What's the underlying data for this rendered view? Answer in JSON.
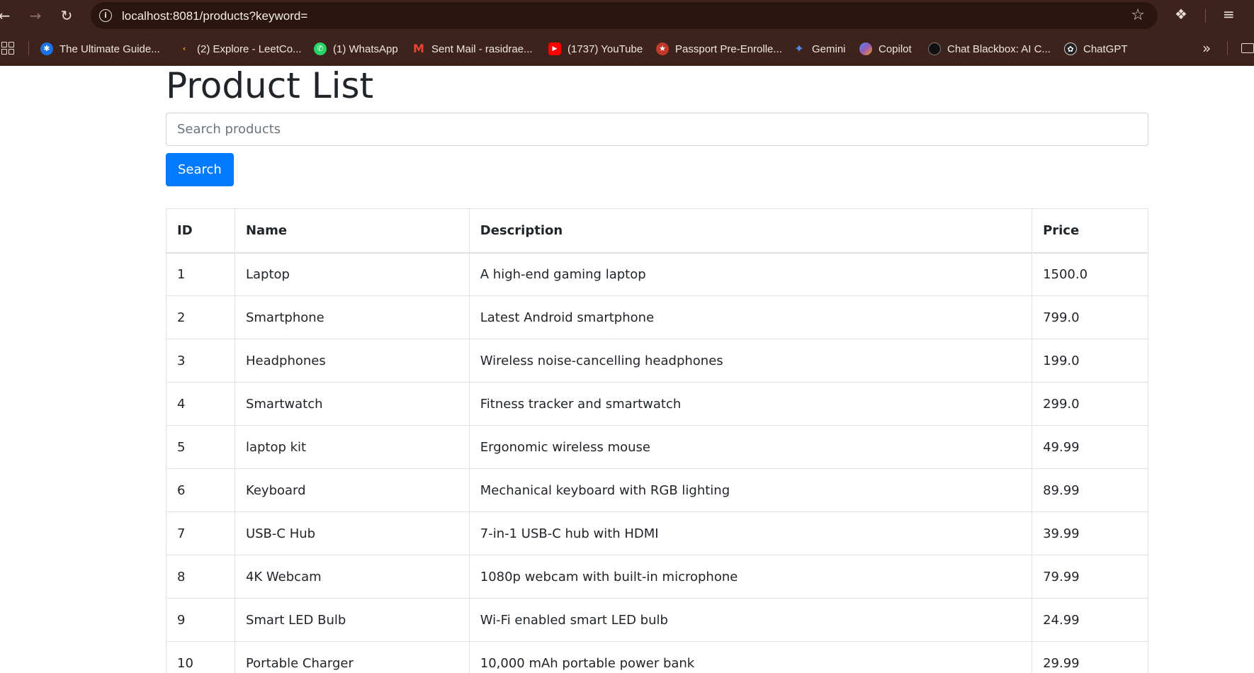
{
  "browser": {
    "url": "localhost:8081/products?keyword=",
    "bookmarks": [
      {
        "label": "The Ultimate Guide...",
        "icon": "bluetooth-icon",
        "color": "#1a73e8"
      },
      {
        "label": "(2) Explore - LeetCo...",
        "icon": "leetcode-icon",
        "color": "#ffa116"
      },
      {
        "label": "(1) WhatsApp",
        "icon": "whatsapp-icon",
        "color": "#25d366"
      },
      {
        "label": "Sent Mail - rasidrae...",
        "icon": "gmail-icon",
        "color": "#ea4335"
      },
      {
        "label": "(1737) YouTube",
        "icon": "youtube-icon",
        "color": "#ff0000"
      },
      {
        "label": "Passport Pre-Enrolle...",
        "icon": "passport-icon",
        "color": "#c0392b"
      },
      {
        "label": "Gemini",
        "icon": "gemini-icon",
        "color": "#4e8cf5"
      },
      {
        "label": "Copilot",
        "icon": "copilot-icon",
        "color": "#9b59b6"
      },
      {
        "label": "Chat Blackbox: AI C...",
        "icon": "blackbox-icon",
        "color": "#111111"
      },
      {
        "label": "ChatGPT",
        "icon": "chatgpt-icon",
        "color": "#222222"
      }
    ]
  },
  "page": {
    "title": "Product List",
    "search_placeholder": "Search products",
    "search_button": "Search"
  },
  "table": {
    "headers": [
      "ID",
      "Name",
      "Description",
      "Price"
    ],
    "rows": [
      [
        "1",
        "Laptop",
        "A high-end gaming laptop",
        "1500.0"
      ],
      [
        "2",
        "Smartphone",
        "Latest Android smartphone",
        "799.0"
      ],
      [
        "3",
        "Headphones",
        "Wireless noise-cancelling headphones",
        "199.0"
      ],
      [
        "4",
        "Smartwatch",
        "Fitness tracker and smartwatch",
        "299.0"
      ],
      [
        "5",
        "laptop kit",
        "Ergonomic wireless mouse",
        "49.99"
      ],
      [
        "6",
        "Keyboard",
        "Mechanical keyboard with RGB lighting",
        "89.99"
      ],
      [
        "7",
        "USB-C Hub",
        "7-in-1 USB-C hub with HDMI",
        "39.99"
      ],
      [
        "8",
        "4K Webcam",
        "1080p webcam with built-in microphone",
        "79.99"
      ],
      [
        "9",
        "Smart LED Bulb",
        "Wi-Fi enabled smart LED bulb",
        "24.99"
      ],
      [
        "10",
        "Portable Charger",
        "10,000 mAh portable power bank",
        "29.99"
      ]
    ]
  }
}
